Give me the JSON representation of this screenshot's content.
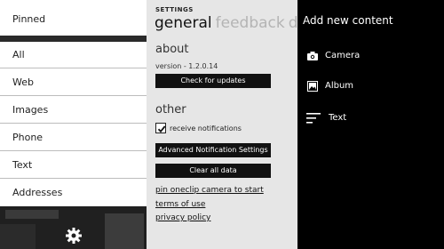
{
  "left_panel": {
    "pinned_label": "Pinned",
    "nav_items": [
      "All",
      "Web",
      "Images",
      "Phone",
      "Text",
      "Addresses"
    ]
  },
  "settings": {
    "header": "SETTINGS",
    "tabs": [
      "general",
      "feedback",
      "dev"
    ],
    "about_heading": "about",
    "version": "version - 1.2.0.14",
    "check_updates": "Check for updates",
    "other_heading": "other",
    "receive_notifications": "receive notifications",
    "notifications_checked": true,
    "advanced_notifications": "Advanced Notification Settings",
    "clear_data": "Clear all data",
    "links": [
      "pin oneclip camera to start",
      "terms of use",
      "privacy policy"
    ]
  },
  "add_content": {
    "title": "Add new content",
    "items": [
      {
        "label": "Camera",
        "icon": "camera-icon"
      },
      {
        "label": "Album",
        "icon": "album-icon"
      },
      {
        "label": "Text",
        "icon": "text-icon"
      }
    ]
  }
}
